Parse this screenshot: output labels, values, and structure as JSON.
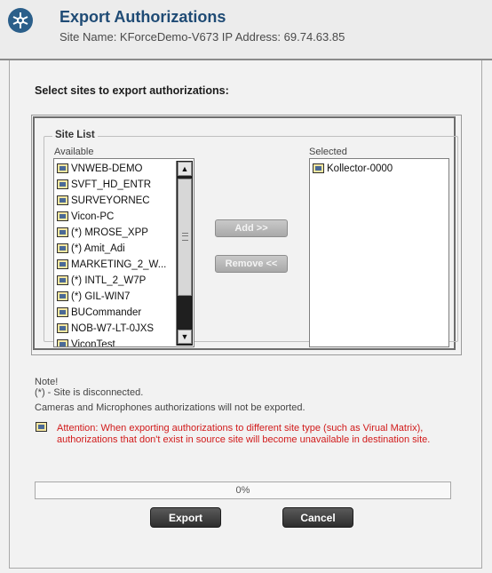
{
  "header": {
    "title": "Export Authorizations",
    "subtitle": "Site Name: KForceDemo-V673   IP Address: 69.74.63.85",
    "icon": "gear-logo-icon"
  },
  "prompt": "Select sites to export authorizations:",
  "site_list": {
    "legend": "Site List",
    "available_label": "Available",
    "selected_label": "Selected",
    "available": [
      "VNWEB-DEMO",
      "SVFT_HD_ENTR",
      "SURVEYORNEC",
      "Vicon-PC",
      "(*) MROSE_XPP",
      "(*) Amit_Adi",
      "MARKETING_2_W...",
      "(*) INTL_2_W7P",
      "(*) GIL-WIN7",
      "BUCommander",
      "NOB-W7-LT-0JXS",
      "ViconTest"
    ],
    "selected": [
      "Kollector-0000"
    ]
  },
  "buttons": {
    "add": "Add >>",
    "remove": "Remove <<",
    "export": "Export",
    "cancel": "Cancel"
  },
  "notes": {
    "note_title": "Note!",
    "note_disconnected": "(*)  - Site is disconnected.",
    "note_cameras": "Cameras and Microphones authorizations will not be exported.",
    "attention_line1": "Attention: When exporting authorizations to different site type (such as Virual Matrix),",
    "attention_line2": "authorizations that don't exist in source site will become unavailable in destination site."
  },
  "progress": {
    "text": "0%",
    "value": 0
  },
  "colors": {
    "title": "#1f4b75",
    "warning": "#d11a1a"
  }
}
